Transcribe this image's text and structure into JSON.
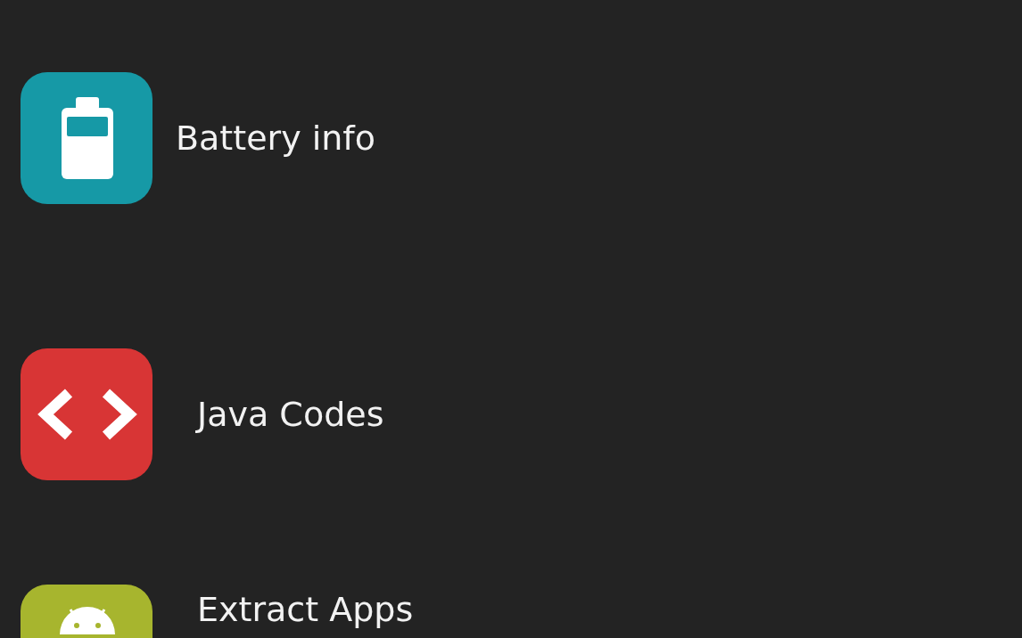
{
  "items": [
    {
      "label": "Battery info",
      "kind": "battery",
      "color": "#1699a6"
    },
    {
      "label": "Java Codes",
      "kind": "code",
      "color": "#d83535"
    },
    {
      "label": "Extract Apps",
      "kind": "android",
      "color": "#a7b52e"
    }
  ]
}
